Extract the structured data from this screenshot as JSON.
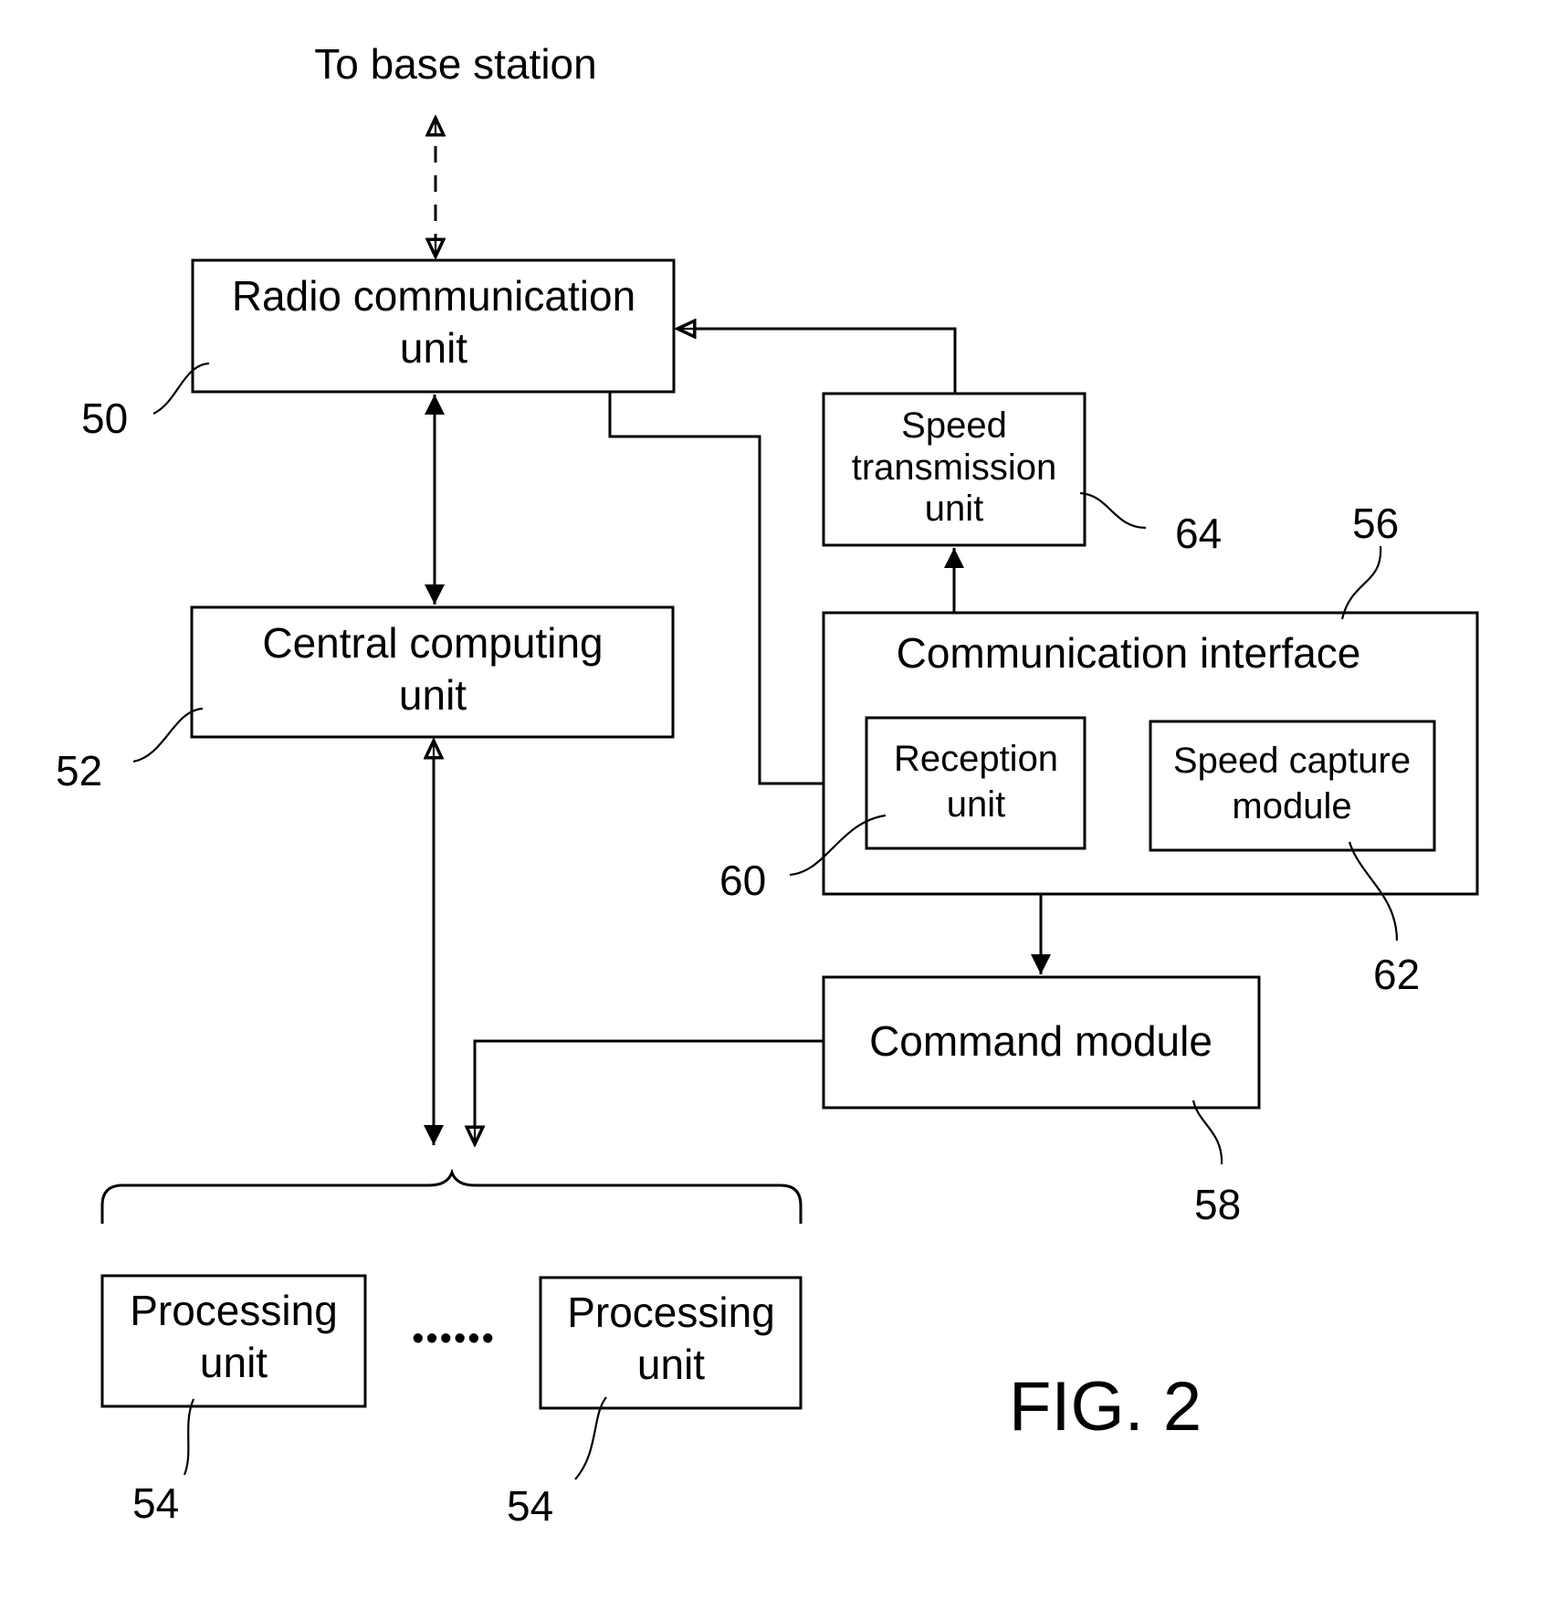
{
  "figure": {
    "caption": "FIG. 2",
    "external_label": "To base station",
    "blocks": {
      "radio": {
        "line1": "Radio communication",
        "line2": "unit",
        "ref": "50"
      },
      "central": {
        "line1": "Central computing",
        "line2": "unit",
        "ref": "52"
      },
      "processing_a": {
        "line1": "Processing",
        "line2": "unit",
        "ref": "54"
      },
      "processing_b": {
        "line1": "Processing",
        "line2": "unit",
        "ref": "54"
      },
      "comm_interface": {
        "title": "Communication interface",
        "ref": "56"
      },
      "reception": {
        "line1": "Reception",
        "line2": "unit",
        "ref": "60"
      },
      "speed_capture": {
        "line1": "Speed capture",
        "line2": "module",
        "ref": "62"
      },
      "speed_transmission": {
        "line1": "Speed",
        "line2": "transmission",
        "line3": "unit",
        "ref": "64"
      },
      "command": {
        "label": "Command module",
        "ref": "58"
      }
    },
    "ellipsis": "••••••"
  }
}
